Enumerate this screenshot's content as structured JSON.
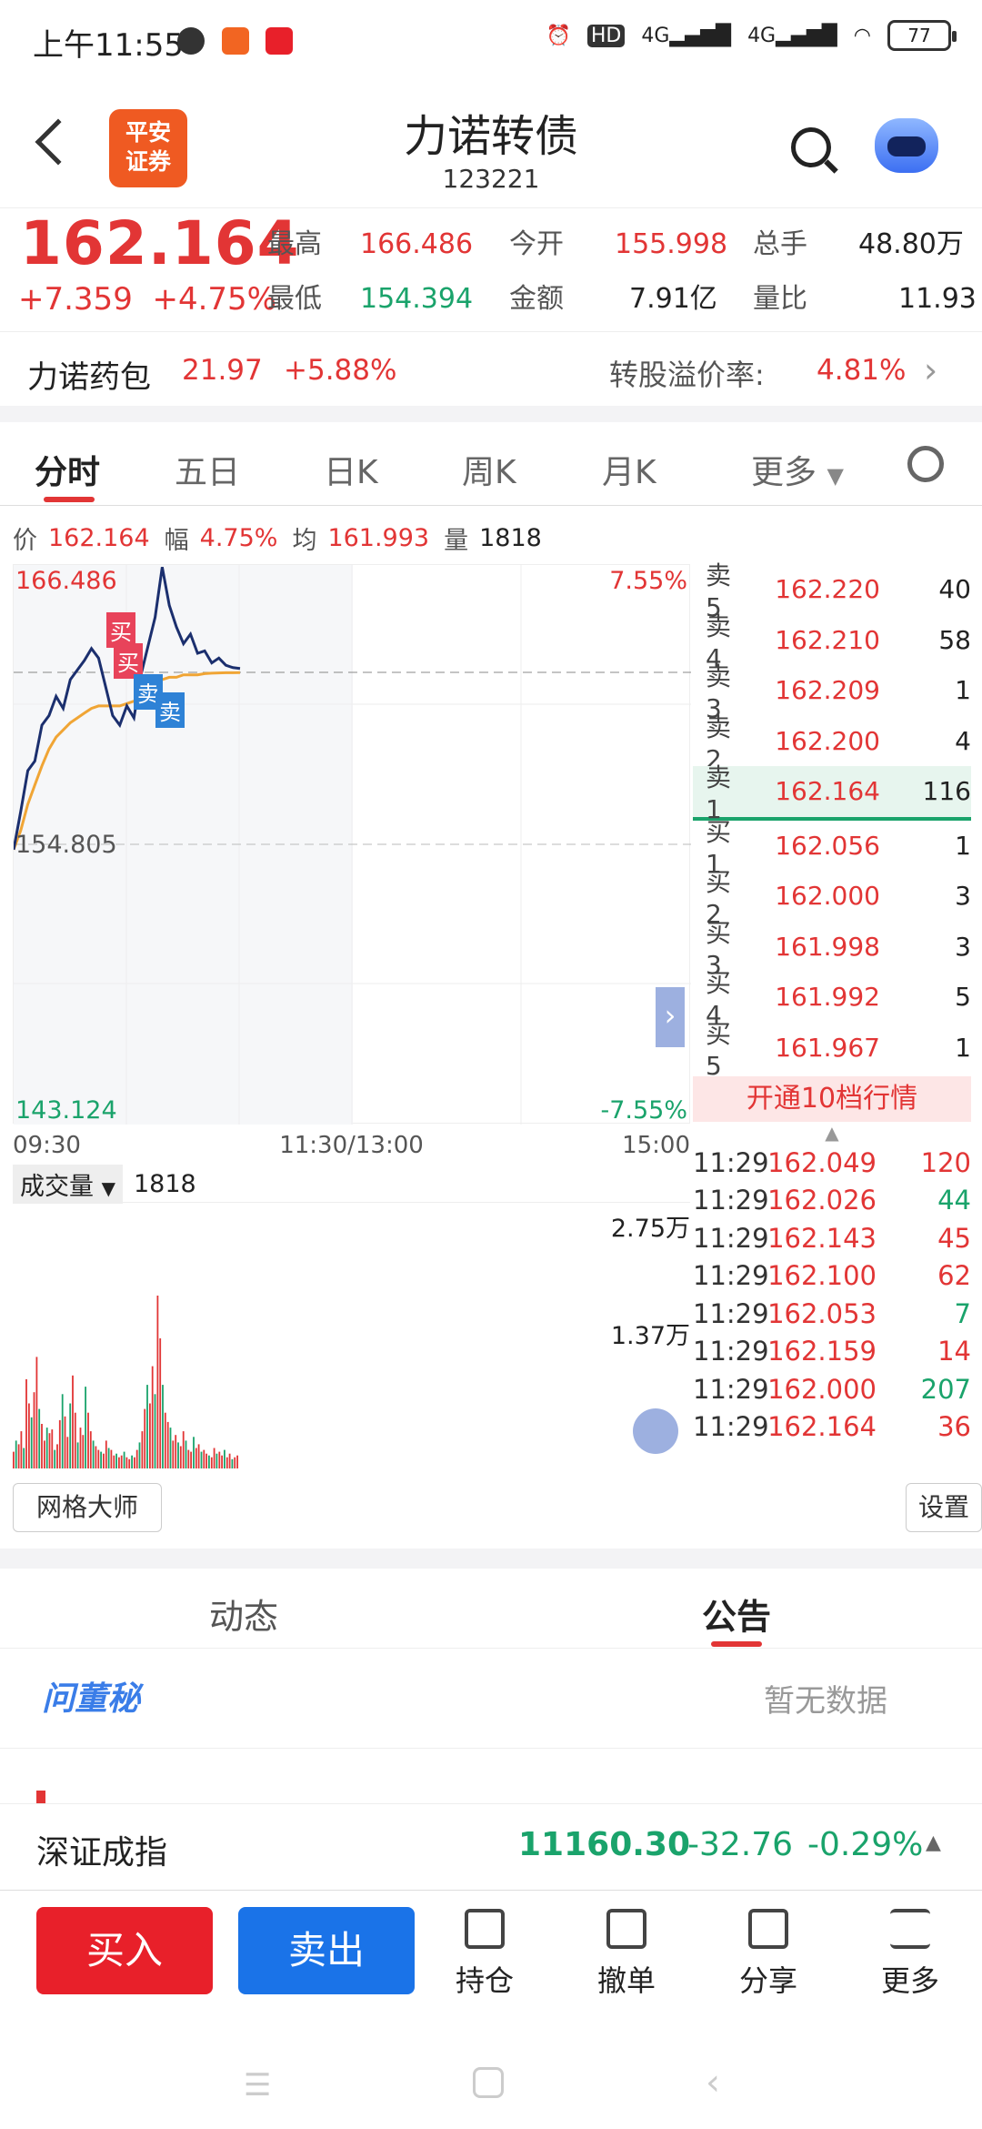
{
  "status": {
    "time": "上午11:55",
    "battery": "77",
    "net1": "4G",
    "net2": "4G",
    "hd": "HD"
  },
  "header": {
    "title": "力诺转债",
    "code": "123221",
    "logo_line1": "平安",
    "logo_line2": "证券"
  },
  "quote": {
    "price": "162.164",
    "change": "+7.359",
    "change_pct": "+4.75%",
    "high_k": "最高",
    "high_v": "166.486",
    "low_k": "最低",
    "low_v": "154.394",
    "open_k": "今开",
    "open_v": "155.998",
    "amount_k": "金额",
    "amount_v": "7.91亿",
    "vol_k": "总手",
    "vol_v": "48.80万",
    "ratio_k": "量比",
    "ratio_v": "11.93"
  },
  "bond": {
    "name": "力诺药包",
    "price": "21.97",
    "pct": "+5.88%",
    "premium_k": "转股溢价率:",
    "premium_v": "4.81%"
  },
  "tabs": [
    "分时",
    "五日",
    "日K",
    "周K",
    "月K",
    "更多"
  ],
  "info": {
    "price_k": "价",
    "price_v": "162.164",
    "amp_k": "幅",
    "amp_v": "4.75%",
    "avg_k": "均",
    "avg_v": "161.993",
    "vol_k": "量",
    "vol_v": "1818"
  },
  "chart": {
    "top": "166.486",
    "mid": "154.805",
    "bottom": "143.124",
    "top_pct": "7.55%",
    "bottom_pct": "-7.55%",
    "t0": "09:30",
    "t1": "11:30/13:00",
    "t2": "15:00",
    "buy": "买",
    "sell": "卖"
  },
  "chart_data": {
    "type": "line",
    "x_range": [
      "09:30",
      "15:00"
    ],
    "ylim": [
      143.124,
      166.486
    ],
    "prev_close": 154.805,
    "price": [
      154.6,
      156.2,
      157.9,
      158.3,
      159.8,
      160.2,
      161.0,
      160.5,
      161.7,
      162.1,
      162.5,
      163.0,
      162.6,
      161.4,
      160.2,
      159.8,
      160.6,
      160.1,
      161.9,
      163.1,
      164.3,
      166.4,
      164.8,
      163.9,
      163.2,
      163.6,
      162.8,
      162.9,
      162.4,
      162.6,
      162.3,
      162.2,
      162.164
    ],
    "avg": [
      154.6,
      155.4,
      156.5,
      157.3,
      158.1,
      158.8,
      159.3,
      159.6,
      159.9,
      160.1,
      160.3,
      160.5,
      160.6,
      160.6,
      160.6,
      160.6,
      160.7,
      160.8,
      161.0,
      161.3,
      161.5,
      161.7,
      161.8,
      161.8,
      161.9,
      161.9,
      161.9,
      161.95,
      161.97,
      161.98,
      161.99,
      161.99,
      161.993
    ]
  },
  "orderbook": {
    "asks": [
      {
        "l": "卖5",
        "p": "162.220",
        "v": "40"
      },
      {
        "l": "卖4",
        "p": "162.210",
        "v": "58"
      },
      {
        "l": "卖3",
        "p": "162.209",
        "v": "1"
      },
      {
        "l": "卖2",
        "p": "162.200",
        "v": "4"
      },
      {
        "l": "卖1",
        "p": "162.164",
        "v": "116"
      }
    ],
    "bids": [
      {
        "l": "买1",
        "p": "162.056",
        "v": "1"
      },
      {
        "l": "买2",
        "p": "162.000",
        "v": "3"
      },
      {
        "l": "买3",
        "p": "161.998",
        "v": "3"
      },
      {
        "l": "买4",
        "p": "161.992",
        "v": "5"
      },
      {
        "l": "买5",
        "p": "161.967",
        "v": "1"
      }
    ],
    "open_btn": "开通10档行情"
  },
  "ticks": [
    {
      "t": "11:29",
      "p": "162.049",
      "v": "120",
      "c": "red"
    },
    {
      "t": "11:29",
      "p": "162.026",
      "v": "44",
      "c": "grn"
    },
    {
      "t": "11:29",
      "p": "162.143",
      "v": "45",
      "c": "red"
    },
    {
      "t": "11:29",
      "p": "162.100",
      "v": "62",
      "c": "red"
    },
    {
      "t": "11:29",
      "p": "162.053",
      "v": "7",
      "c": "grn"
    },
    {
      "t": "11:29",
      "p": "162.159",
      "v": "14",
      "c": "red"
    },
    {
      "t": "11:29",
      "p": "162.000",
      "v": "207",
      "c": "grn"
    },
    {
      "t": "11:29",
      "p": "162.164",
      "v": "36",
      "c": "red"
    }
  ],
  "volume": {
    "label": "成交量",
    "value": "1818",
    "max": "2.75万",
    "mid": "1.37万"
  },
  "volume_data": [
    18,
    30,
    26,
    40,
    22,
    96,
    70,
    55,
    82,
    120,
    64,
    48,
    30,
    44,
    38,
    42,
    20,
    26,
    52,
    80,
    56,
    34,
    70,
    100,
    60,
    28,
    44,
    36,
    88,
    60,
    40,
    30,
    24,
    20,
    18,
    16,
    30,
    22,
    20,
    14,
    16,
    12,
    14,
    18,
    12,
    10,
    14,
    12,
    20,
    28,
    40,
    64,
    90,
    70,
    110,
    80,
    186,
    140,
    90,
    60,
    50,
    44,
    30,
    36,
    28,
    24,
    40,
    30,
    20,
    18,
    34,
    22,
    26,
    18,
    20,
    16,
    14,
    12,
    22,
    16,
    18,
    14,
    20,
    12,
    16,
    10,
    12,
    14
  ],
  "buttons": {
    "grid": "网格大师",
    "settings": "设置"
  },
  "news": {
    "tab1": "动态",
    "tab2": "公告",
    "brand": "问董秘",
    "nodata": "暂无数据"
  },
  "index": {
    "name": "深证成指",
    "value": "11160.30",
    "change": "-32.76",
    "pct": "-0.29%"
  },
  "bottom": {
    "buy": "买入",
    "sell": "卖出",
    "hold": "持仓",
    "cancel": "撤单",
    "share": "分享",
    "more": "更多"
  },
  "colors": {
    "red": "#e23535",
    "green": "#1aa36b",
    "blue": "#1a73e8",
    "orange": "#ef5a22"
  }
}
